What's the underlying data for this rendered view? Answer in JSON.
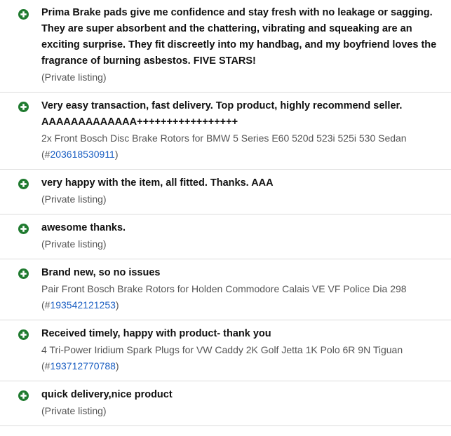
{
  "feedback": [
    {
      "comment": "Prima Brake pads give me confidence and stay fresh with no leakage or sagging. They are super absorbent and the chattering, vibrating and squeaking are an exciting surprise. They fit discreetly into my handbag, and my boyfriend loves the fragrance of burning asbestos. FIVE STARS!",
      "listing": "(Private listing)"
    },
    {
      "comment": "Very easy transaction, fast delivery. Top product, highly recommend seller. AAAAAAAAAAAAA+++++++++++++++++",
      "item_title": "2x Front Bosch Disc Brake Rotors for BMW 5 Series E60 520d 523i 525i 530 Sedan",
      "item_number": "203618530911"
    },
    {
      "comment": "very happy with the item, all fitted. Thanks. AAA",
      "listing": "(Private listing)"
    },
    {
      "comment": "awesome thanks.",
      "listing": "(Private listing)"
    },
    {
      "comment": "Brand new, so no issues",
      "item_title": "Pair Front Bosch Brake Rotors for Holden Commodore Calais VE VF Police Dia 298",
      "item_number": "193542121253"
    },
    {
      "comment": "Received timely, happy with product- thank you",
      "item_title": "4 Tri-Power Iridium Spark Plugs for VW Caddy 2K Golf Jetta 1K Polo 6R 9N Tiguan",
      "item_number": "193712770788"
    },
    {
      "comment": "quick delivery,nice product",
      "listing": "(Private listing)"
    }
  ],
  "labels": {
    "item_open": "(#",
    "item_close": ")"
  },
  "colors": {
    "positive_icon": "#1f7a2f",
    "link": "#1a5ec2",
    "divider": "#dcdcdc"
  },
  "icons": {
    "positive": "plus-circle-icon"
  }
}
